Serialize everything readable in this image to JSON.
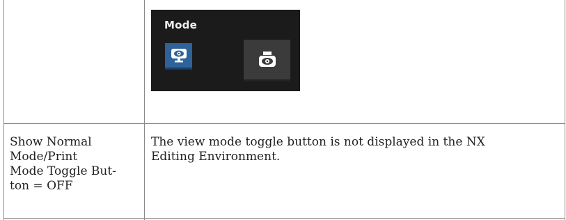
{
  "table": {
    "row1": {
      "screenshot": {
        "title": "Mode",
        "buttons": [
          {
            "name": "normal-mode",
            "icon": "monitor-eye-icon",
            "state": "selected",
            "color": "#2f6299"
          },
          {
            "name": "print-mode",
            "icon": "printer-eye-icon",
            "state": "unselected",
            "color": "#3b3b3b"
          }
        ]
      }
    },
    "row2": {
      "setting_lines": [
        "Show Normal",
        "Mode/Print",
        "Mode Toggle But-",
        "ton = OFF"
      ],
      "description_lines": [
        "The view mode toggle button is not displayed in the NX",
        "Editing Environment."
      ]
    }
  }
}
